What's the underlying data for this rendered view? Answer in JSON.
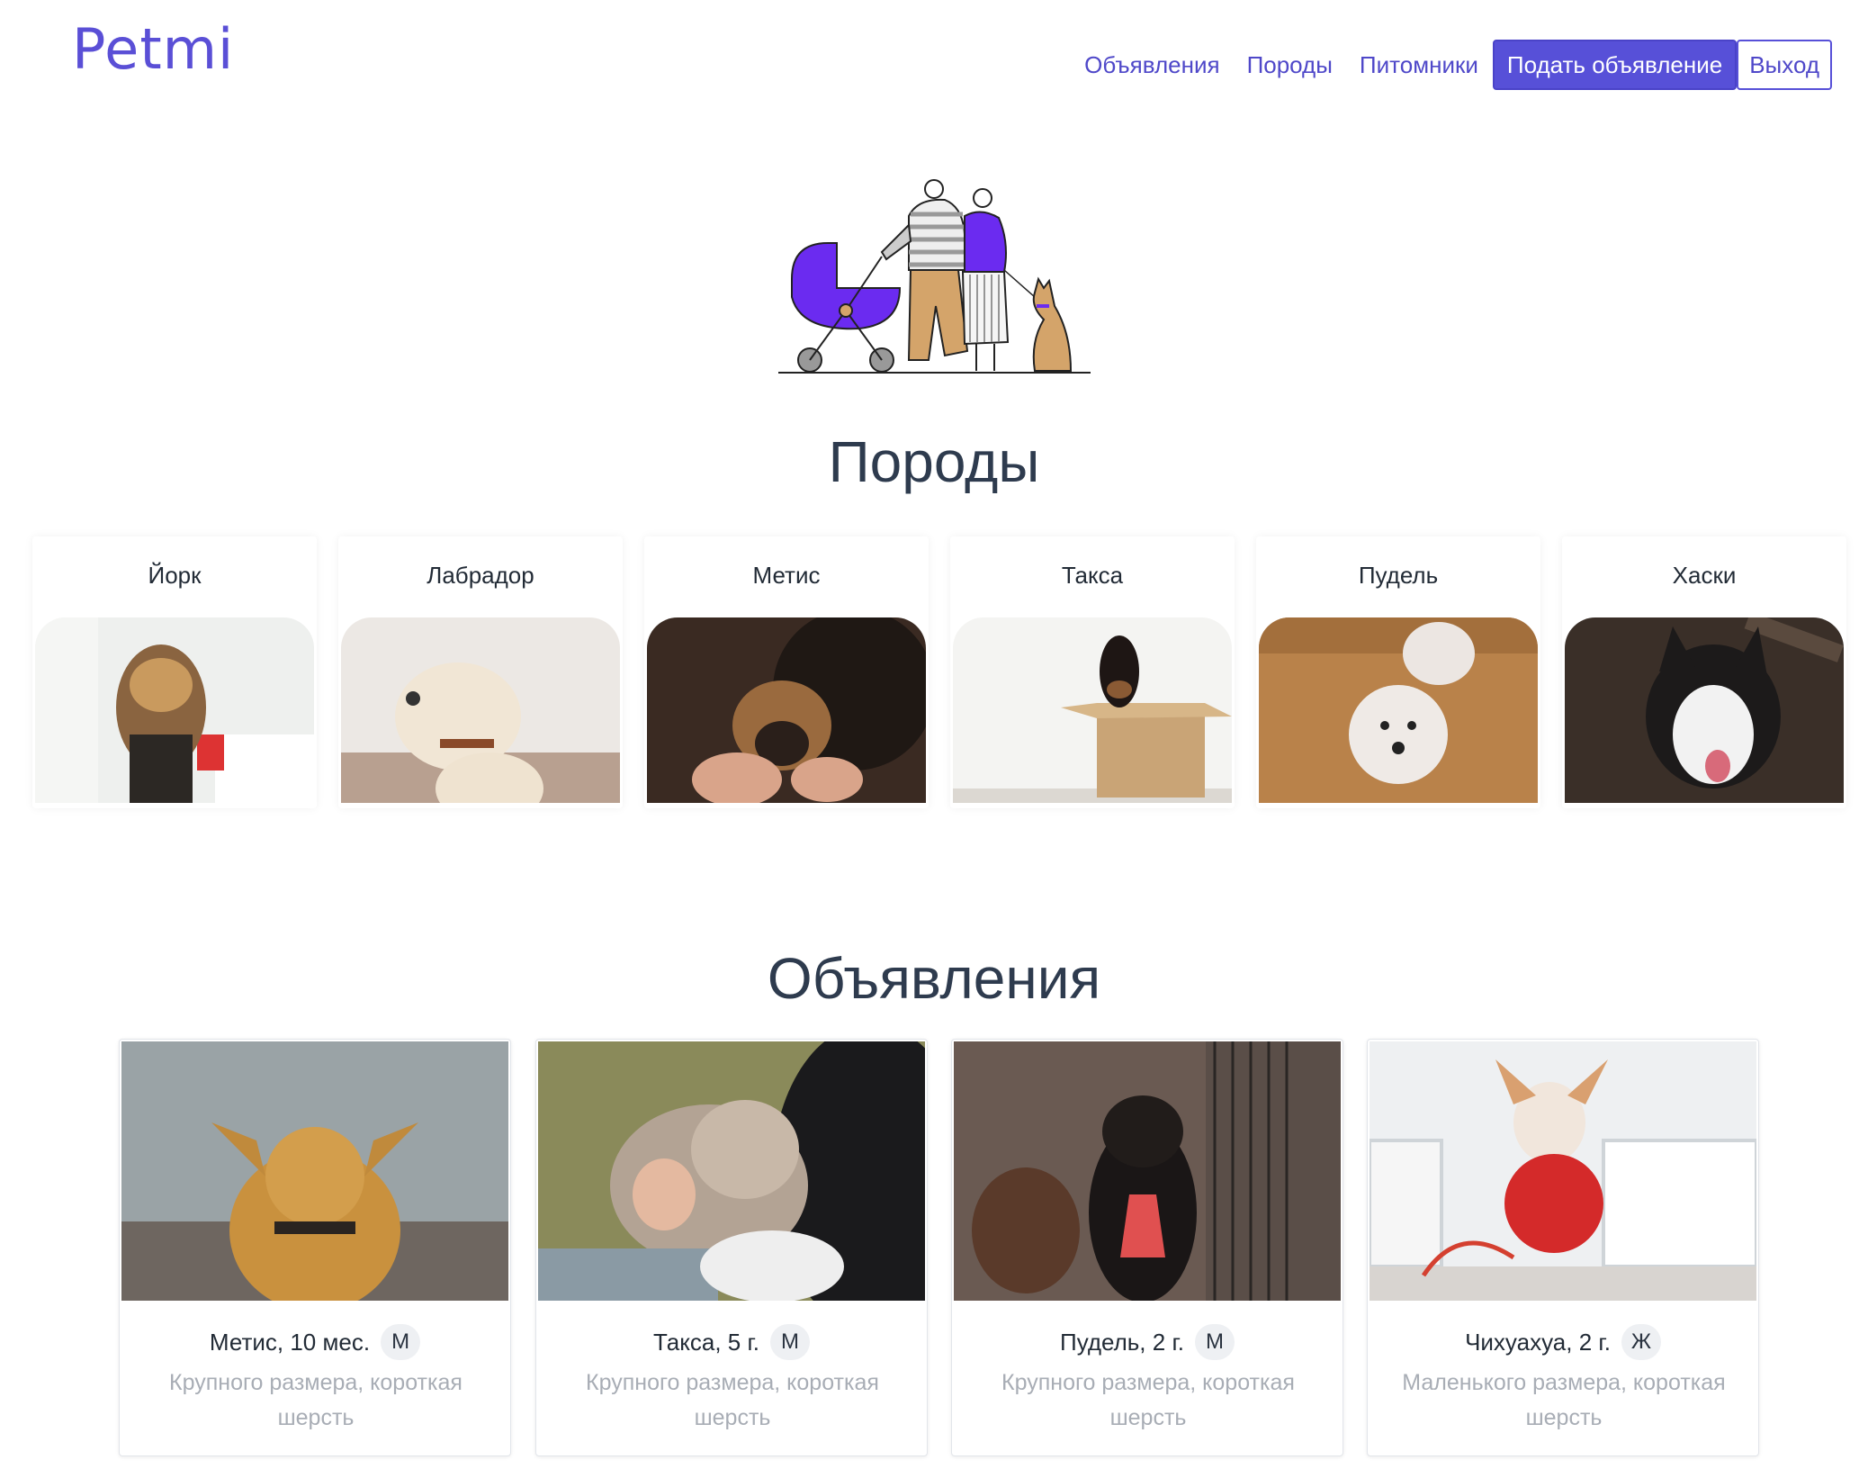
{
  "header": {
    "logo": "Petmi",
    "nav": {
      "listings": "Объявления",
      "breeds": "Породы",
      "kennels": "Питомники",
      "post_ad": "Подать объявление",
      "logout": "Выход"
    }
  },
  "breeds_section": {
    "title": "Породы",
    "items": [
      {
        "name": "Йорк"
      },
      {
        "name": "Лабрадор"
      },
      {
        "name": "Метис"
      },
      {
        "name": "Такса"
      },
      {
        "name": "Пудель"
      },
      {
        "name": "Хаски"
      }
    ]
  },
  "listings_section": {
    "title": "Объявления",
    "items": [
      {
        "title": "Метис, 10 мес.",
        "sex": "М",
        "description": "Крупного размера, короткая шерсть"
      },
      {
        "title": "Такса, 5 г.",
        "sex": "М",
        "description": "Крупного размера, короткая шерсть"
      },
      {
        "title": "Пудель, 2 г.",
        "sex": "М",
        "description": "Крупного размера, короткая шерсть"
      },
      {
        "title": "Чихуахуа, 2 г.",
        "sex": "Ж",
        "description": "Маленького размера, короткая шерсть"
      }
    ]
  },
  "colors": {
    "brand": "#5750d8",
    "heading": "#2e3b4e",
    "muted_text": "#a8adb5"
  }
}
